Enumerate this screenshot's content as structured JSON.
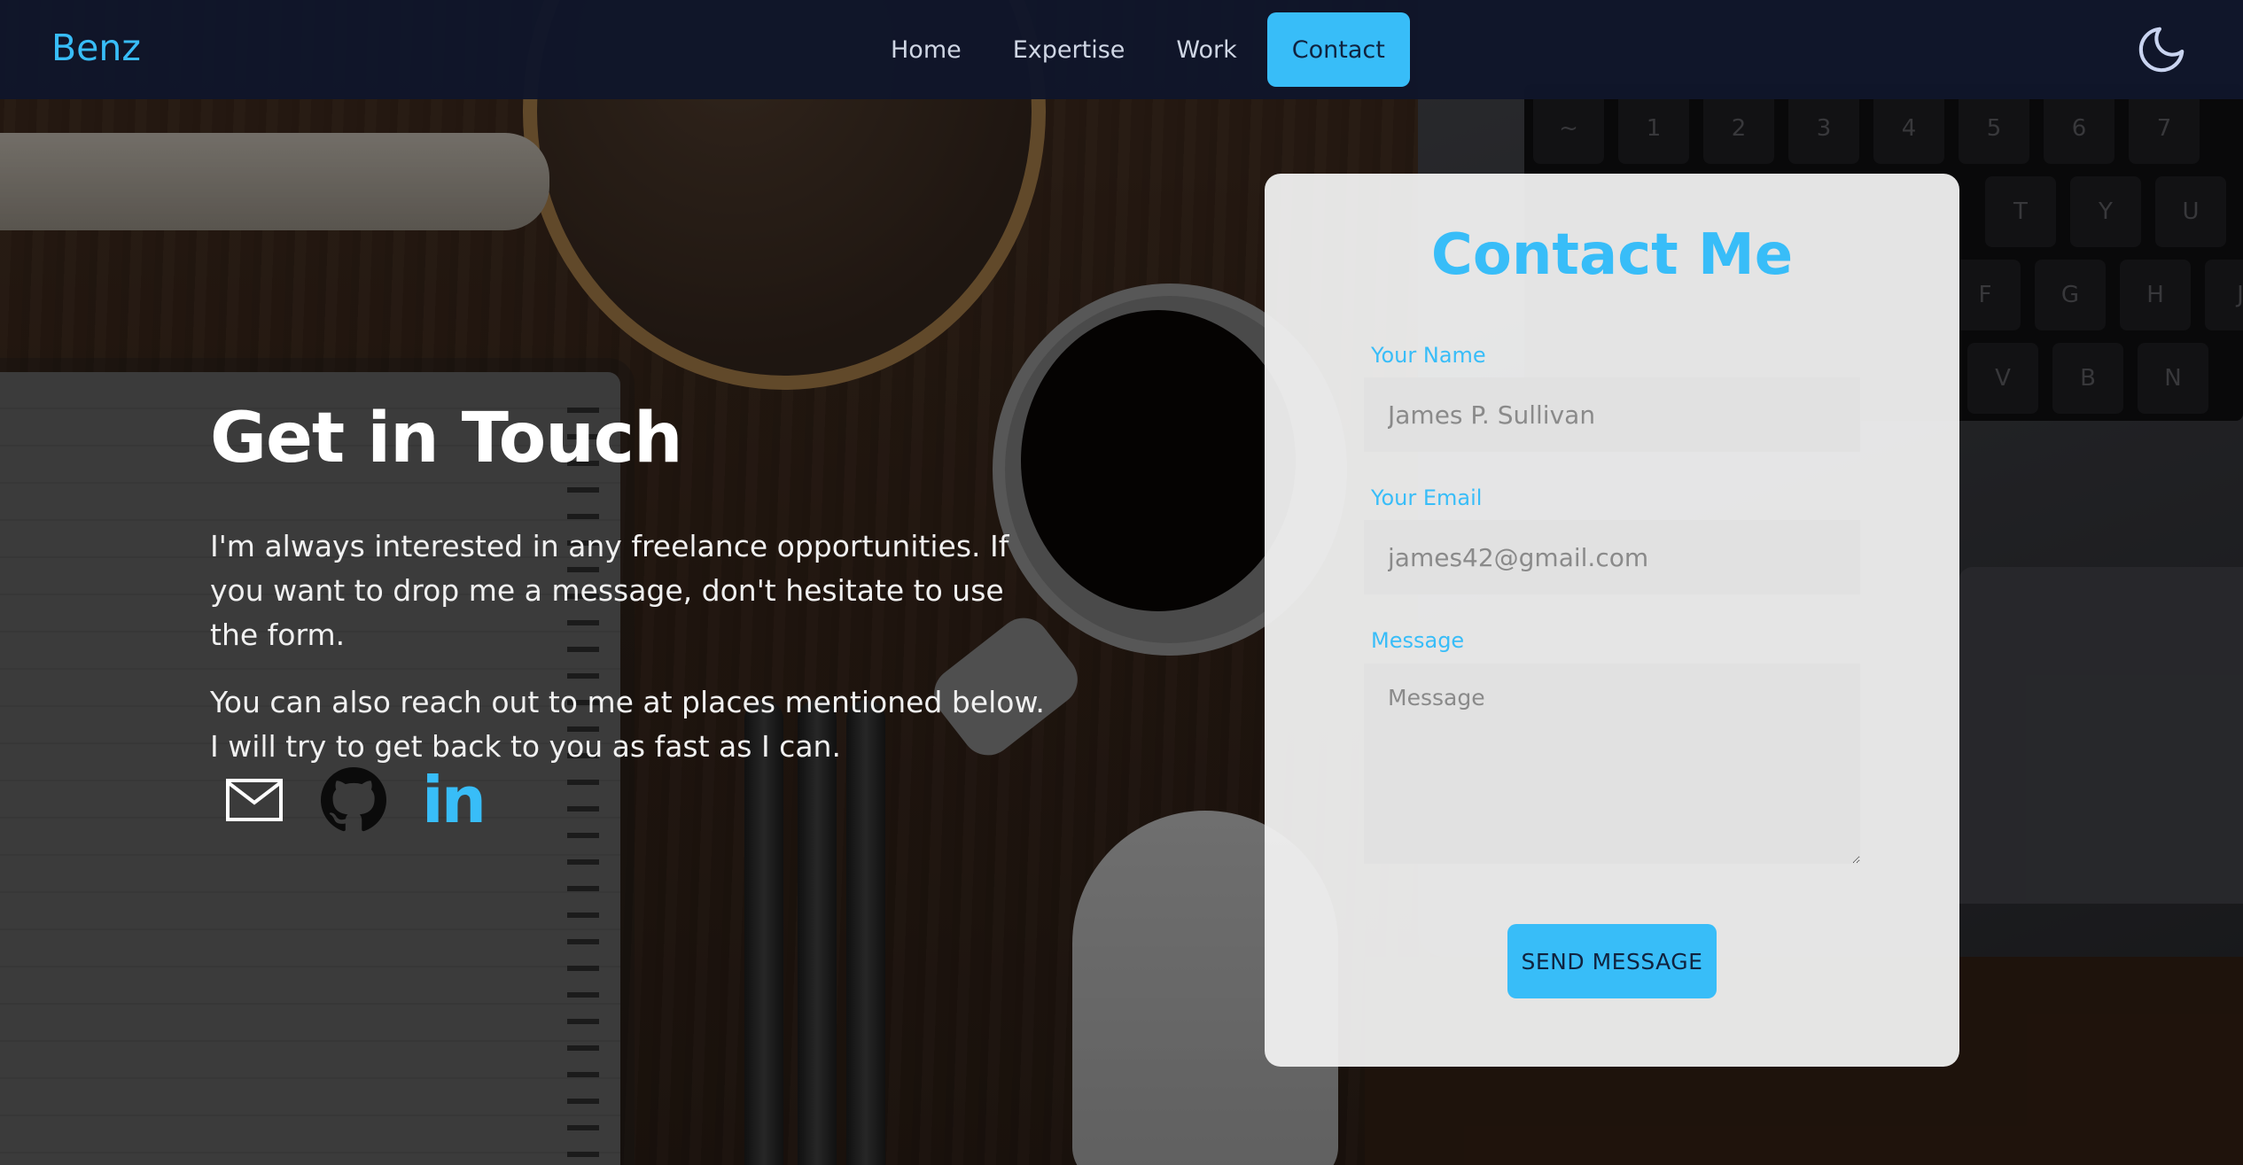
{
  "nav": {
    "brand": "Benz",
    "links": [
      {
        "label": "Home"
      },
      {
        "label": "Expertise"
      },
      {
        "label": "Work"
      },
      {
        "label": "Contact",
        "active": true
      }
    ],
    "theme_toggle_icon": "moon-icon"
  },
  "hero": {
    "title": "Get in Touch",
    "paragraph1": "I'm always interested in any freelance opportunities. If you want to drop me a message, don't hesitate to use the form.",
    "paragraph2": "You can also reach out to me at places mentioned below. I will try to get back to you as fast as I can.",
    "socials": [
      {
        "icon": "mail-icon"
      },
      {
        "icon": "github-icon"
      },
      {
        "icon": "linkedin-icon",
        "text": "in"
      }
    ]
  },
  "contact_form": {
    "title": "Contact Me",
    "name_label": "Your Name",
    "name_placeholder": "James P. Sullivan",
    "email_label": "Your Email",
    "email_placeholder": "james42@gmail.com",
    "message_label": "Message",
    "message_placeholder": "Message",
    "submit_label": "SEND MESSAGE"
  },
  "colors": {
    "accent": "#38bdf8",
    "navbar_bg": "#10162a",
    "card_bg": "#f0f0f0",
    "field_bg": "#e1e1e1"
  },
  "keyboard_keys": [
    "~",
    "1",
    "2",
    "3",
    "4",
    "5",
    "6",
    "7",
    "T",
    "Y",
    "U",
    "F",
    "G",
    "H",
    "J",
    "V",
    "B",
    "N"
  ]
}
